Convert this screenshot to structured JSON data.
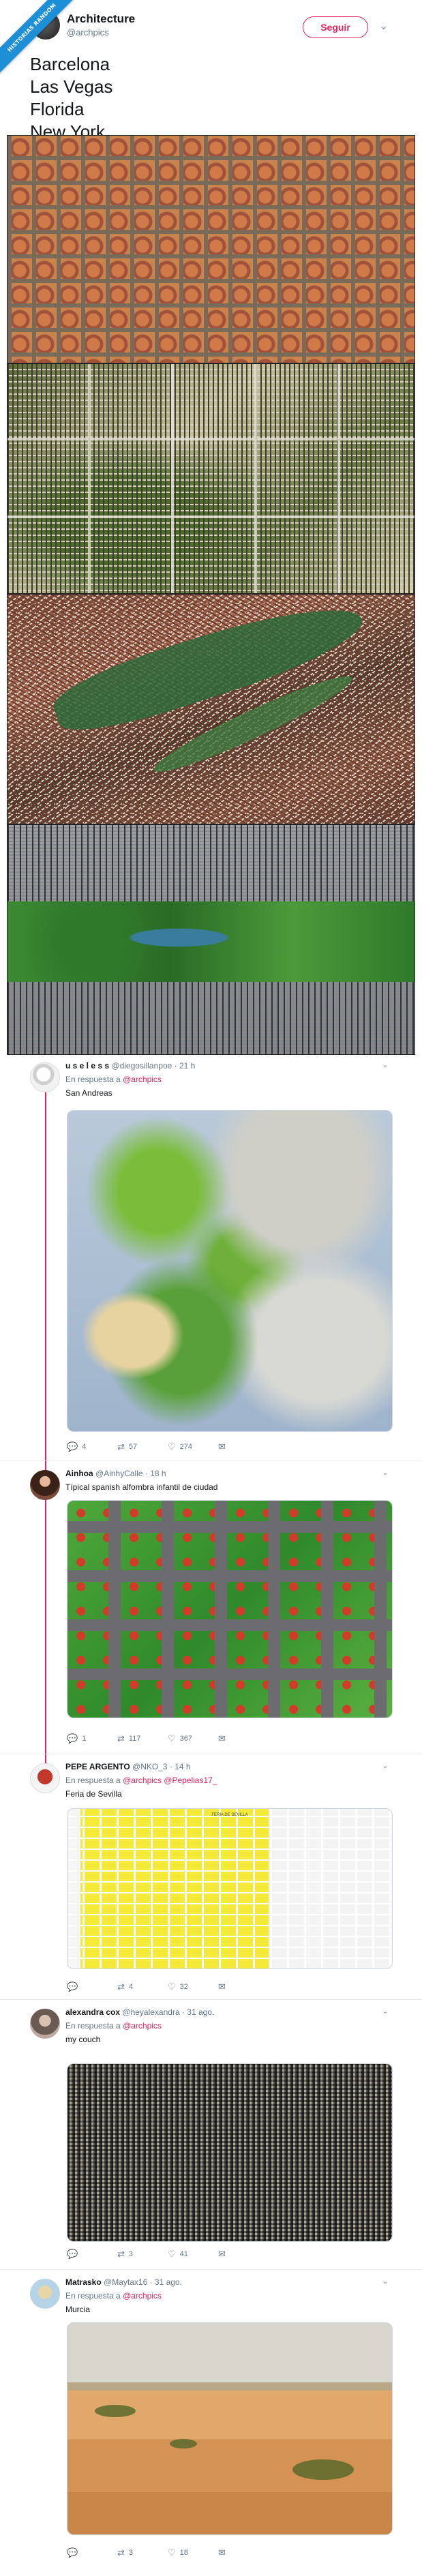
{
  "ribbon": "HISTORIAS RANDOM",
  "tweet": {
    "name": "Architecture",
    "handle": "@archpics",
    "follow_label": "Seguir",
    "lines": [
      "Barcelona",
      "Las Vegas",
      "Florida",
      "New York"
    ]
  },
  "replies": [
    {
      "name": "u s e l e s s",
      "handle": "@diegosillanpoe · 21 h",
      "reply_prefix": "En respuesta a ",
      "reply_to": "@archpics",
      "text": "San Andreas",
      "replies_count": "4",
      "retweets": "57",
      "likes": "274"
    },
    {
      "name": "Ainhoa",
      "handle": "@AinhyCalle · 18 h",
      "reply_prefix": "",
      "reply_to": "",
      "text": "Típical spanish alfombra infantil de ciudad",
      "replies_count": "1",
      "retweets": "117",
      "likes": "367"
    },
    {
      "name": "PEPE ARGENTO",
      "handle": "@NKO_3 · 14 h",
      "reply_prefix": "En respuesta a ",
      "reply_to": "@archpics @Pepelias17_",
      "text": "Feria de Sevilla",
      "image_caption": "FERIA DE SEVILLA",
      "replies_count": "",
      "retweets": "4",
      "likes": "32"
    },
    {
      "name": "alexandra cox",
      "handle": "@heyalexandra · 31 ago.",
      "reply_prefix": "En respuesta a ",
      "reply_to": "@archpics",
      "text": "my couch",
      "replies_count": "",
      "retweets": "3",
      "likes": "41"
    },
    {
      "name": "Matrasko",
      "handle": "@Maytax16 · 31 ago.",
      "reply_prefix": "En respuesta a ",
      "reply_to": "@archpics",
      "text": "Murcia",
      "replies_count": "",
      "retweets": "3",
      "likes": "18"
    }
  ],
  "icons": {
    "reply": "💬",
    "retweet": "⇄",
    "like": "♡",
    "mail": "✉",
    "chevron": "⌄"
  }
}
